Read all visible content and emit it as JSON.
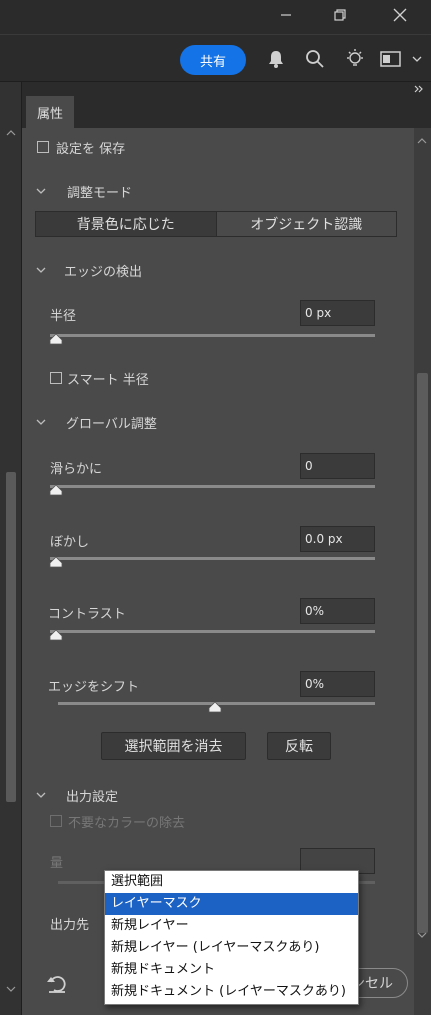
{
  "toolbar": {
    "share_label": "共有"
  },
  "panel": {
    "tab_label": "属性",
    "save_settings": "設定を 保存",
    "mode_section": "調整モード",
    "mode_options": [
      "背景色に応じた",
      "オブジェクト認識"
    ],
    "edge_section": "エッジの検出",
    "radius_label": "半径",
    "radius_value": "0 px",
    "radius_fraction": 0,
    "smart_radius_label": "スマート 半径",
    "global_section": "グローバル調整",
    "smooth_label": "滑らかに",
    "smooth_value": "0",
    "feather_label": "ぼかし",
    "feather_value": "0.0 px",
    "contrast_label": "コントラスト",
    "contrast_value": "0%",
    "shift_label": "エッジをシフト",
    "shift_value": "0%",
    "clear_selection_label": "選択範囲を消去",
    "invert_label": "反転",
    "output_section": "出力設定",
    "decontaminate_label": "不要なカラーの除去",
    "amount_label": "量",
    "output_to_label": "出力先",
    "cancel_label": "ンセル"
  },
  "output_menu": {
    "items": [
      "選択範囲",
      "レイヤーマスク",
      "新規レイヤー",
      "新規レイヤー (レイヤーマスクあり)",
      "新規ドキュメント",
      "新規ドキュメント (レイヤーマスクあり)"
    ],
    "selected_index": 1
  }
}
